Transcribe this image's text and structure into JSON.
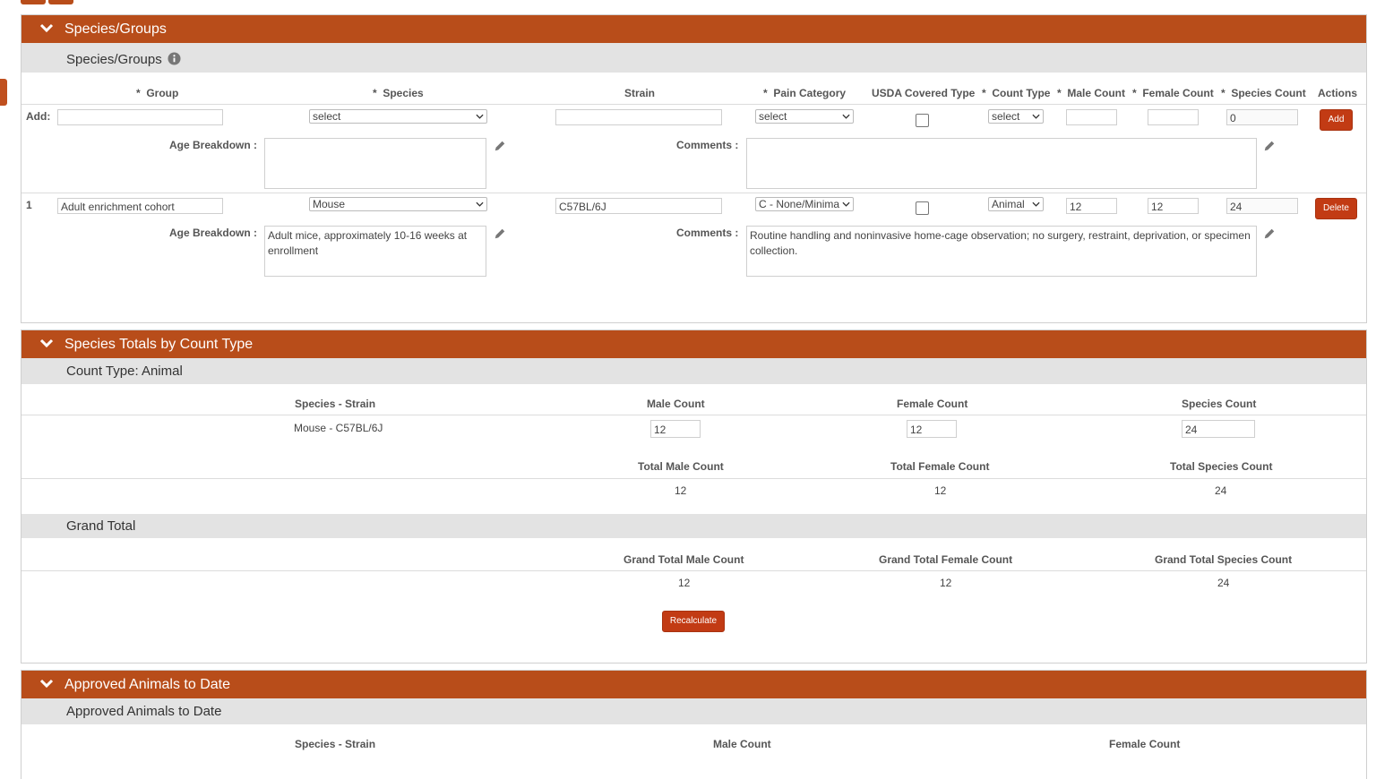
{
  "colors": {
    "header": "#b84d1a",
    "button": "#c23b14",
    "subheader": "#e3e3e3"
  },
  "species_groups": {
    "title": "Species/Groups",
    "subtitle": "Species/Groups",
    "columns": {
      "group": "Group",
      "species": "Species",
      "strain": "Strain",
      "pain_category": "Pain Category",
      "usda": "USDA Covered Type",
      "count_type": "Count Type",
      "male": "Male Count",
      "female": "Female Count",
      "species_count": "Species Count",
      "actions": "Actions"
    },
    "required_mark": "*",
    "add_row": {
      "label": "Add:",
      "group": "",
      "species": "select",
      "strain": "",
      "pain_category": "select",
      "usda_checked": false,
      "count_type": "select",
      "male": "",
      "female": "",
      "species_count": "0",
      "button": "Add",
      "age_label": "Age Breakdown :",
      "age_value": "",
      "comments_label": "Comments :",
      "comments_value": ""
    },
    "rows": [
      {
        "index": "1",
        "group": "Adult enrichment cohort",
        "species": "Mouse",
        "strain": "C57BL/6J",
        "pain_category": "C - None/Minimal",
        "usda_checked": false,
        "count_type": "Animal",
        "male": "12",
        "female": "12",
        "species_count": "24",
        "button": "Delete",
        "age_label": "Age Breakdown :",
        "age_value": "Adult mice, approximately 10-16 weeks at enrollment",
        "comments_label": "Comments :",
        "comments_value": "Routine handling and noninvasive home-cage observation; no surgery, restraint, deprivation, or specimen collection."
      }
    ]
  },
  "totals": {
    "title": "Species Totals by Count Type",
    "count_type_label": "Count Type: Animal",
    "columns": {
      "species_strain": "Species - Strain",
      "male": "Male Count",
      "female": "Female Count",
      "species": "Species Count"
    },
    "row": {
      "species_strain": "Mouse - C57BL/6J",
      "male": "12",
      "female": "12",
      "species": "24"
    },
    "total_labels": {
      "male": "Total Male Count",
      "female": "Total Female Count",
      "species": "Total Species Count"
    },
    "total_values": {
      "male": "12",
      "female": "12",
      "species": "24"
    },
    "grand_title": "Grand Total",
    "grand_labels": {
      "male": "Grand Total Male Count",
      "female": "Grand Total Female Count",
      "species": "Grand Total Species Count"
    },
    "grand_values": {
      "male": "12",
      "female": "12",
      "species": "24"
    },
    "recalculate": "Recalculate"
  },
  "approved": {
    "title": "Approved Animals to Date",
    "subtitle": "Approved Animals to Date",
    "columns": {
      "species_strain": "Species - Strain",
      "male": "Male Count",
      "female": "Female Count"
    }
  }
}
